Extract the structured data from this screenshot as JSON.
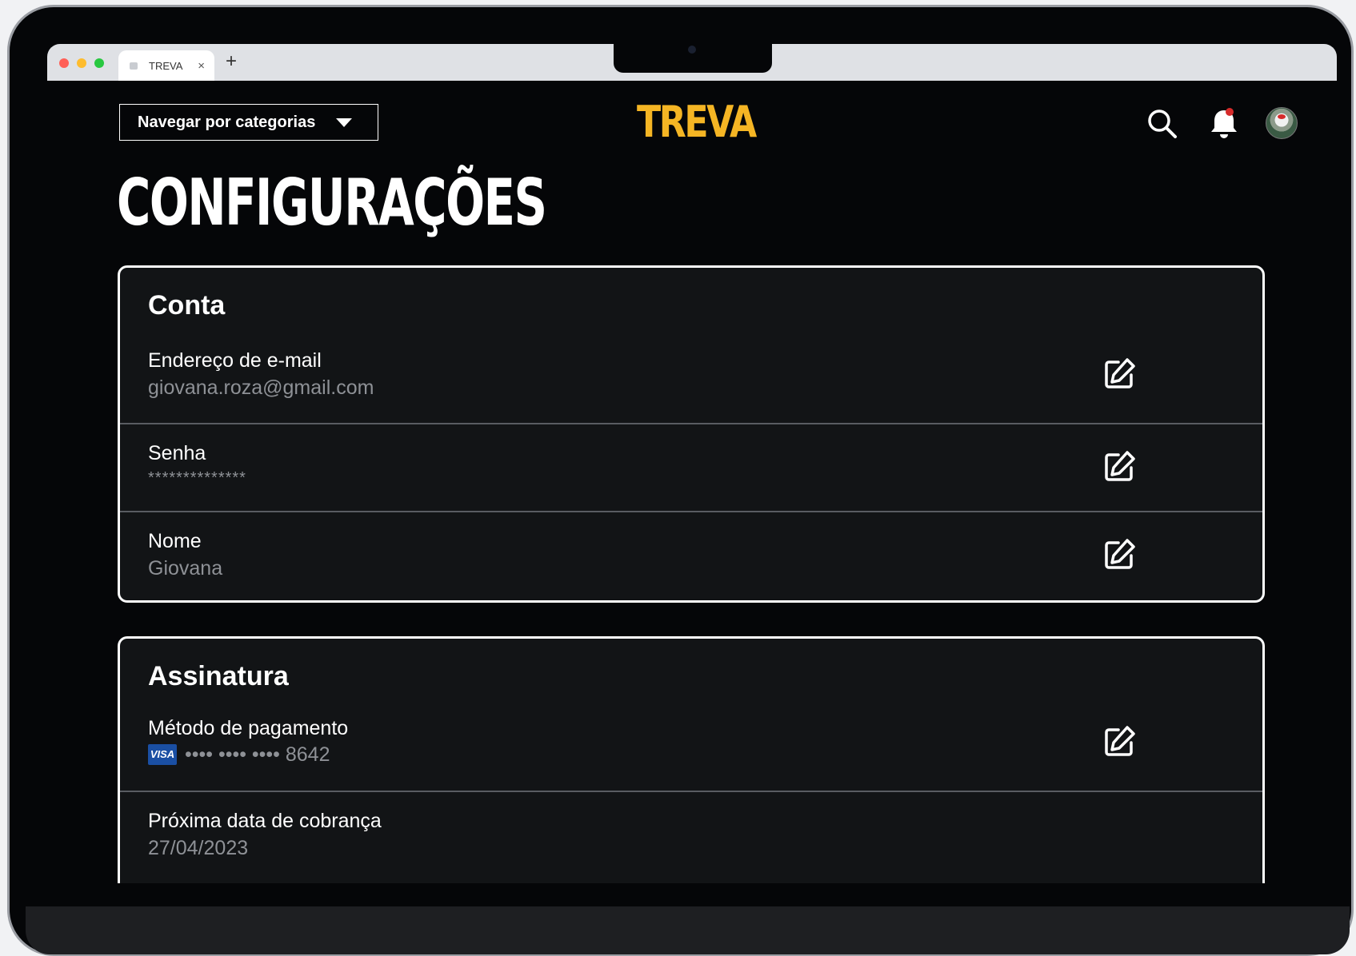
{
  "browser": {
    "tab_title": "TREVA",
    "tab_close": "×",
    "new_tab": "+"
  },
  "header": {
    "categories_button": "Navegar por categorias",
    "logo": "TREVA",
    "icons": [
      "search-icon",
      "bell-icon",
      "avatar"
    ]
  },
  "page_title": "CONFIGURAÇÕES",
  "conta": {
    "title": "Conta",
    "rows": [
      {
        "label": "Endereço de e-mail",
        "value": "giovana.roza@gmail.com"
      },
      {
        "label": "Senha",
        "value": "**************"
      },
      {
        "label": "Nome",
        "value": "Giovana"
      }
    ]
  },
  "assinatura": {
    "title": "Assinatura",
    "rows": [
      {
        "label": "Método de pagamento",
        "card_brand": "VISA",
        "value": "•••• •••• •••• 8642"
      },
      {
        "label": "Próxima data de cobrança",
        "value": "27/04/2023"
      }
    ]
  },
  "colors": {
    "background": "#050608",
    "card": "#121416",
    "accent": "#f5b524",
    "muted_text": "#8e9196",
    "notification_dot": "#d62b2b"
  }
}
